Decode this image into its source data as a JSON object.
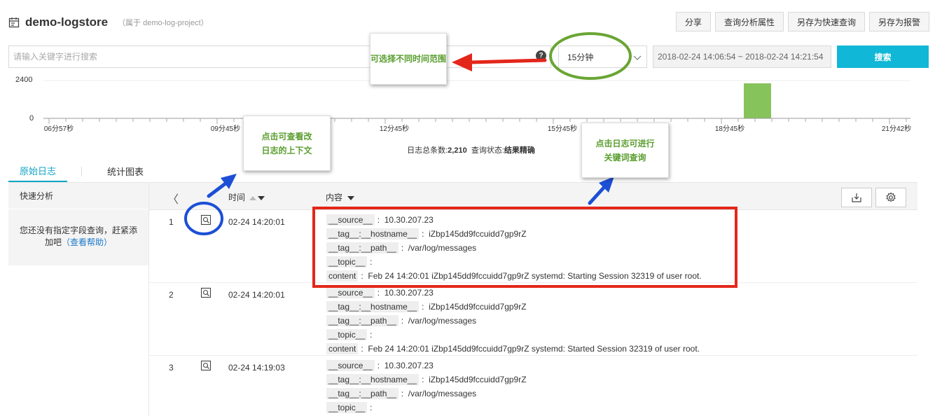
{
  "header": {
    "title": "demo-logstore",
    "subtitle": "（属于 demo-log-project）",
    "buttons": [
      "分享",
      "查询分析属性",
      "另存为快速查询",
      "另存为报警"
    ]
  },
  "search": {
    "placeholder": "请输入关键字进行搜索",
    "help": "?",
    "time_preset": "15分钟",
    "time_range": "2018-02-24 14:06:54 ~ 2018-02-24 14:21:54",
    "submit_label": "搜索"
  },
  "histogram": {
    "y_max_label": "2400",
    "y_min_label": "0",
    "x_labels": [
      "06分57秒",
      "09分45秒",
      "12分45秒",
      "15分45秒",
      "18分45秒",
      "21分42秒"
    ],
    "bar_color": "#86c35a"
  },
  "summary": {
    "count_label": "日志总条数:",
    "count_value": "2,210",
    "status_label": "查询状态:",
    "status_value": "结果精确"
  },
  "tabs": [
    "原始日志",
    "统计图表"
  ],
  "sidebar": {
    "title": "快速分析",
    "hint_text": "您还没有指定字段查询，赶紧添加吧",
    "hint_link": "（查看帮助）"
  },
  "log_table": {
    "back": "〈",
    "col_time": "时间",
    "col_content": "内容",
    "rows": [
      {
        "num": "1",
        "time": "02-24 14:20:01",
        "fields": [
          {
            "k": "__source__",
            "v": "10.30.207.23"
          },
          {
            "k": "__tag__:__hostname__",
            "v": "iZbp145dd9fccuidd7gp9rZ"
          },
          {
            "k": "__tag__:__path__",
            "v": "/var/log/messages"
          },
          {
            "k": "__topic__",
            "v": ""
          },
          {
            "k": "content",
            "v": "Feb 24 14:20:01 iZbp145dd9fccuidd7gp9rZ systemd: Starting Session 32319 of user root."
          }
        ]
      },
      {
        "num": "2",
        "time": "02-24 14:20:01",
        "fields": [
          {
            "k": "__source__",
            "v": "10.30.207.23"
          },
          {
            "k": "__tag__:__hostname__",
            "v": "iZbp145dd9fccuidd7gp9rZ"
          },
          {
            "k": "__tag__:__path__",
            "v": "/var/log/messages"
          },
          {
            "k": "__topic__",
            "v": ""
          },
          {
            "k": "content",
            "v": "Feb 24 14:20:01 iZbp145dd9fccuidd7gp9rZ systemd: Started Session 32319 of user root."
          }
        ]
      },
      {
        "num": "3",
        "time": "02-24 14:19:03",
        "fields": [
          {
            "k": "__source__",
            "v": "10.30.207.23"
          },
          {
            "k": "__tag__:__hostname__",
            "v": "iZbp145dd9fccuidd7gp9rZ"
          },
          {
            "k": "__tag__:__path__",
            "v": "/var/log/messages"
          },
          {
            "k": "__topic__",
            "v": ""
          }
        ]
      }
    ]
  },
  "annotations": {
    "time_range_note": "可选择不同时间范围",
    "context_note": "点击可查看改日志的上下文",
    "keyword_note": "点击日志可进行关键词查询"
  },
  "colors": {
    "accent": "#10b7d6",
    "tab_active": "#10a5c7",
    "annotation_green": "#5a9e2f",
    "highlight_red": "#e3271b",
    "arrow_blue": "#1c4fd6"
  }
}
